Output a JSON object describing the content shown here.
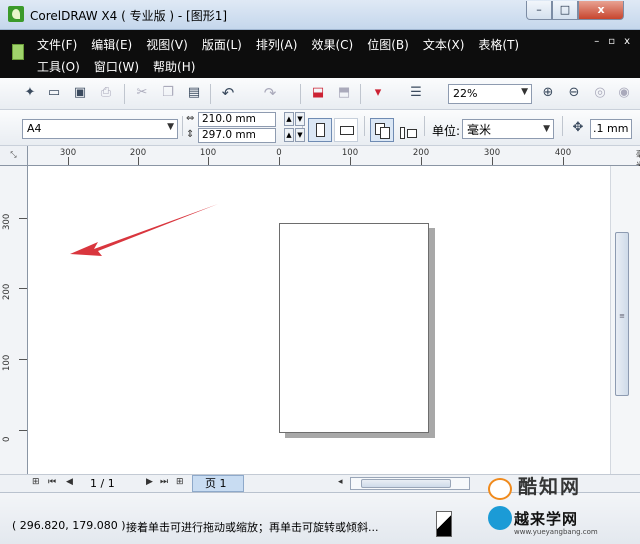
{
  "window": {
    "title": "CorelDRAW X4 ( 专业版 ) - [图形1]",
    "controls": {
      "minimize": "–",
      "maximize": "□",
      "close": "x"
    }
  },
  "menubar": {
    "row1": [
      "文件(F)",
      "编辑(E)",
      "视图(V)",
      "版面(L)",
      "排列(A)",
      "效果(C)",
      "位图(B)",
      "文本(X)",
      "表格(T)"
    ],
    "row2": [
      "工具(O)",
      "窗口(W)",
      "帮助(H)"
    ],
    "mdi": {
      "minimize": "–",
      "restore": "▫",
      "close": "x"
    }
  },
  "toolbar": {
    "icons": [
      "new-icon",
      "open-icon",
      "save-icon",
      "print-icon",
      "cut-icon",
      "copy-icon",
      "paste-icon",
      "undo-icon",
      "redo-icon",
      "import-icon",
      "export-icon",
      "launcher-icon",
      "options-icon"
    ],
    "zoom": "22%"
  },
  "property_bar": {
    "paper_size": "A4",
    "width": "210.0 mm",
    "height": "297.0 mm",
    "unit_label": "单位:",
    "unit": "毫米",
    "nudge": ".1 mm"
  },
  "rulers": {
    "horizontal": [
      "300",
      "200",
      "100",
      "0",
      "100",
      "200",
      "300",
      "400"
    ],
    "vertical": [
      "300",
      "200",
      "100",
      "0"
    ],
    "unit": "毫米"
  },
  "page_nav": {
    "count": "1 / 1",
    "tab": "页 1"
  },
  "status": {
    "coords": "( 296.820, 179.080 )",
    "hint": "接着单击可进行拖动或缩放；再单击可旋转或倾斜..."
  },
  "watermark": {
    "top": "酷知网",
    "bottom": "越来学网",
    "url": "www.yueyangbang.com"
  },
  "colors": {
    "menubar_bg": "#0d0d0d",
    "arrow": "#d9363e",
    "page_tab": "#c8dcf2"
  }
}
